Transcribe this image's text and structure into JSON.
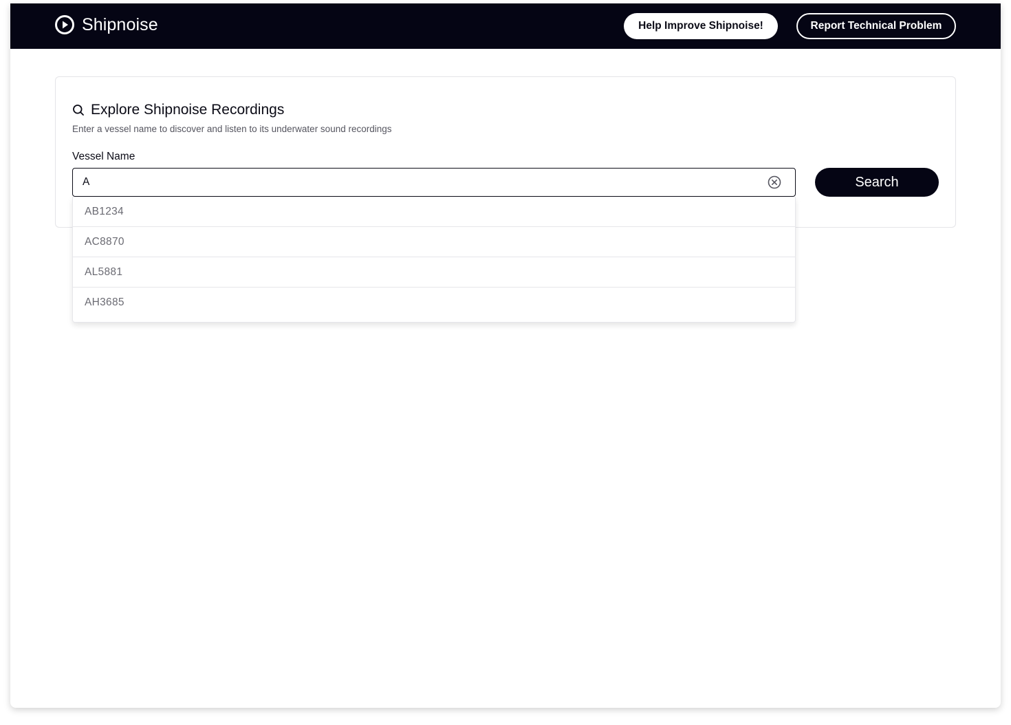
{
  "header": {
    "brand_name": "Shipnoise",
    "brand_icon": "play-circle-icon",
    "help_button_label": "Help Improve Shipnoise!",
    "report_button_label": "Report Technical Problem",
    "background_color": "#050514"
  },
  "search_card": {
    "title_icon": "search-icon",
    "title": "Explore Shipnoise Recordings",
    "subtitle": "Enter a vessel name to discover and listen to its underwater sound recordings",
    "field_label": "Vessel Name",
    "input_value": "A",
    "clear_icon": "clear-circle-icon",
    "search_button_label": "Search"
  },
  "suggestions": [
    "AB1234",
    "AC8870",
    "AL5881",
    "AH3685"
  ]
}
